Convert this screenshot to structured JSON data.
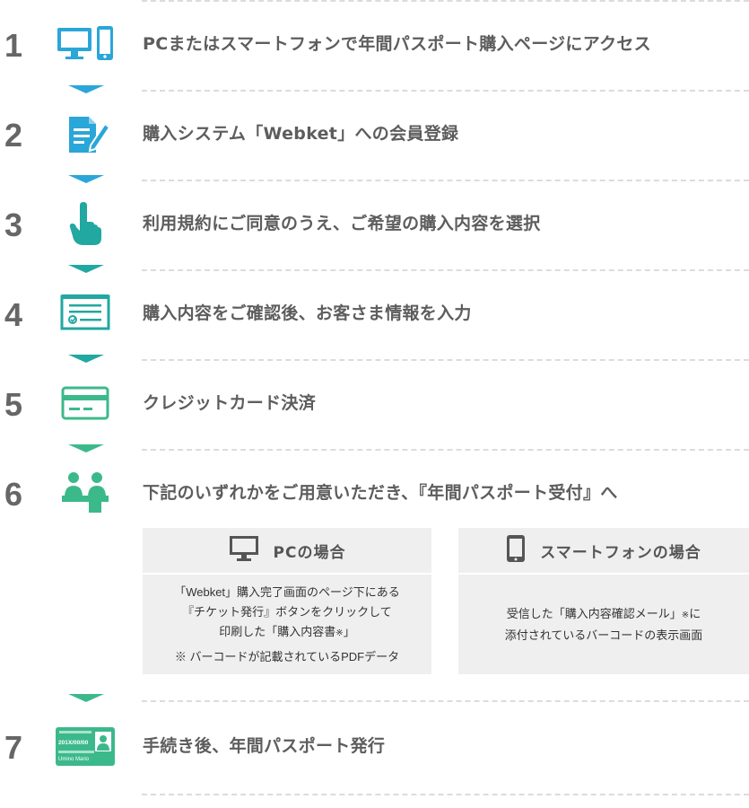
{
  "steps": [
    {
      "number": "1",
      "title": "PCまたはスマートフォンで年間パスポート購入ページにアクセス",
      "icon": "devices-icon"
    },
    {
      "number": "2",
      "title": "購入システム「Webket」への会員登録",
      "icon": "document-edit-icon"
    },
    {
      "number": "3",
      "title": "利用規約にご同意のうえ、ご希望の購入内容を選択",
      "icon": "pointing-hand-icon"
    },
    {
      "number": "4",
      "title": "購入内容をご確認後、お客さま情報を入力",
      "icon": "form-checklist-icon"
    },
    {
      "number": "5",
      "title": "クレジットカード決済",
      "icon": "credit-card-icon"
    },
    {
      "number": "6",
      "title": "下記のいずれかをご用意いただき、『年間パスポート受付』へ",
      "icon": "reception-people-icon"
    },
    {
      "number": "7",
      "title": "手続き後、年間パスポート発行",
      "icon": "annual-pass-card-icon"
    }
  ],
  "options": {
    "pc": {
      "title": "PCの場合",
      "line1": "「Webket」購入完了画面のページ下にある",
      "line2": "『チケット発行』ボタンをクリックして",
      "line3a": "印刷した「購入内容書",
      "line3mark": "※",
      "line3b": "」",
      "note": "※ バーコードが記載されているPDFデータ"
    },
    "smartphone": {
      "title": "スマートフォンの場合",
      "line1a": "受信した「購入内容確認メール」",
      "line1mark": "※",
      "line1b": "に",
      "line2": "添付されているバーコードの表示画面"
    }
  },
  "pass_card": {
    "date": "201X/00/00",
    "name": "Umino Mario"
  },
  "colors": {
    "blue": "#2aa6d8",
    "teal": "#21a8a1",
    "green": "#3cb98b",
    "number_gray": "#666666"
  }
}
